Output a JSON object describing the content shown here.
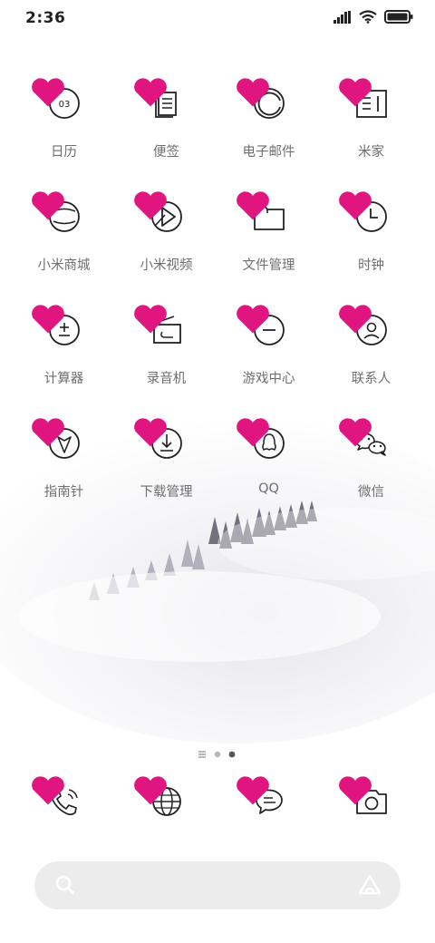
{
  "status": {
    "time": "2:36"
  },
  "apps": [
    {
      "label": "日历",
      "icon": "calendar-icon",
      "text": "03"
    },
    {
      "label": "便签",
      "icon": "notes-icon"
    },
    {
      "label": "电子邮件",
      "icon": "email-icon"
    },
    {
      "label": "米家",
      "icon": "mijia-icon"
    },
    {
      "label": "小米商城",
      "icon": "mi-store-icon"
    },
    {
      "label": "小米视频",
      "icon": "mi-video-icon"
    },
    {
      "label": "文件管理",
      "icon": "folder-icon"
    },
    {
      "label": "时钟",
      "icon": "clock-icon"
    },
    {
      "label": "计算器",
      "icon": "calculator-icon"
    },
    {
      "label": "录音机",
      "icon": "recorder-icon"
    },
    {
      "label": "游戏中心",
      "icon": "game-center-icon"
    },
    {
      "label": "联系人",
      "icon": "contacts-icon"
    },
    {
      "label": "指南针",
      "icon": "compass-icon"
    },
    {
      "label": "下载管理",
      "icon": "download-icon"
    },
    {
      "label": "QQ",
      "icon": "qq-icon"
    },
    {
      "label": "微信",
      "icon": "wechat-icon"
    }
  ],
  "dock": [
    {
      "icon": "phone-icon"
    },
    {
      "icon": "browser-icon"
    },
    {
      "icon": "messages-icon"
    },
    {
      "icon": "camera-icon"
    }
  ],
  "pager": {
    "pages": 2,
    "current": 2
  },
  "colors": {
    "heart": "#e0157f",
    "icon_stroke": "#222222",
    "label": "#6e6e6e"
  }
}
